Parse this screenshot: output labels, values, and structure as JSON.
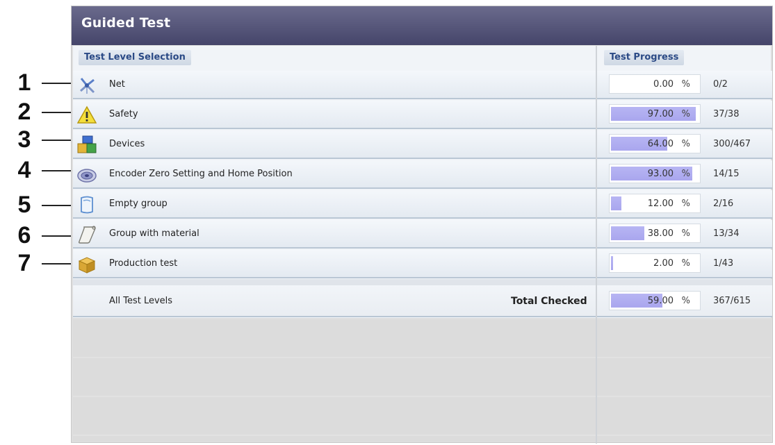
{
  "window": {
    "title": "Guided Test"
  },
  "headers": {
    "selection": "Test Level Selection",
    "progress": "Test Progress"
  },
  "callouts": [
    "1",
    "2",
    "3",
    "4",
    "5",
    "6",
    "7"
  ],
  "rows": [
    {
      "label": "Net",
      "icon": "net-icon",
      "percent": "0.00",
      "fraction": 0.0,
      "count": "0/2"
    },
    {
      "label": "Safety",
      "icon": "warning-icon",
      "percent": "97.00",
      "fraction": 0.97,
      "count": "37/38"
    },
    {
      "label": "Devices",
      "icon": "devices-icon",
      "percent": "64.00",
      "fraction": 0.64,
      "count": "300/467"
    },
    {
      "label": "Encoder Zero Setting and Home Position",
      "icon": "encoder-icon",
      "percent": "93.00",
      "fraction": 0.93,
      "count": "14/15"
    },
    {
      "label": "Empty group",
      "icon": "empty-group-icon",
      "percent": "12.00",
      "fraction": 0.12,
      "count": "2/16"
    },
    {
      "label": "Group with material",
      "icon": "scroll-icon",
      "percent": "38.00",
      "fraction": 0.38,
      "count": "13/34"
    },
    {
      "label": "Production test",
      "icon": "box-icon",
      "percent": "2.00",
      "fraction": 0.02,
      "count": "1/43"
    }
  ],
  "total": {
    "label": "All Test Levels",
    "checked_label": "Total Checked",
    "percent": "59.00",
    "fraction": 0.59,
    "count": "367/615"
  },
  "units": {
    "percent_sign": "%"
  },
  "colors": {
    "title_bar": "#45456a",
    "progress_fill": "#aaa7ef",
    "header_text": "#2b4a86"
  }
}
